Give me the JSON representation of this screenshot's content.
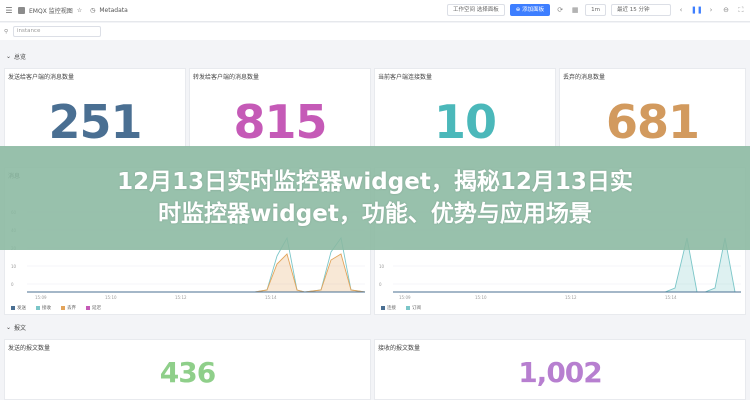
{
  "topbar": {
    "tab1": "EMQX 监控视图",
    "tab2": "Metadata",
    "btn_workspace": "工作空间 选择面板",
    "btn_add": "添加面板",
    "time_label": "1m",
    "time_range": "最近 15 分钟",
    "colors": {
      "primary": "#3d7eff"
    }
  },
  "filterbar": {
    "label": "instance"
  },
  "sections": {
    "top": "总览",
    "bottom": "报文"
  },
  "panels": [
    {
      "title": "发送给客户端的消息数量",
      "value": "251",
      "color": "#4a6f92"
    },
    {
      "title": "转发给客户端的消息数量",
      "value": "815",
      "color": "#c55ab7"
    },
    {
      "title": "当前客户端连接数量",
      "value": "10",
      "color": "#4bb8ba"
    },
    {
      "title": "丢弃的消息数量",
      "value": "681",
      "color": "#d29a5e"
    }
  ],
  "chart_panels": [
    {
      "title": "消息",
      "x_ticks": [
        "15:09",
        "15:10",
        "15:12",
        "15:14"
      ]
    },
    {
      "title": "",
      "x_ticks": [
        "15:09",
        "15:10",
        "15:12",
        "15:14"
      ]
    }
  ],
  "legend_items": [
    {
      "label": "发送",
      "color": "#4a6f92"
    },
    {
      "label": "接收",
      "color": "#7bc6c8"
    },
    {
      "label": "丢弃",
      "color": "#e3a45b"
    },
    {
      "label": "延迟",
      "color": "#c55ab7"
    }
  ],
  "legend_items_right": [
    {
      "label": "连接",
      "color": "#4a6f92"
    },
    {
      "label": "订阅",
      "color": "#7bc6c8"
    }
  ],
  "bottom_panels": [
    {
      "title": "发送的报文数量",
      "value": "436",
      "color": "#8fcf8a"
    },
    {
      "title": "接收的报文数量",
      "value": "1,002",
      "color": "#b77fd0"
    }
  ],
  "banner": {
    "line1": "12月13日实时监控器widget，揭秘12月13日实",
    "line2": "时监控器widget，功能、优势与应用场景"
  }
}
